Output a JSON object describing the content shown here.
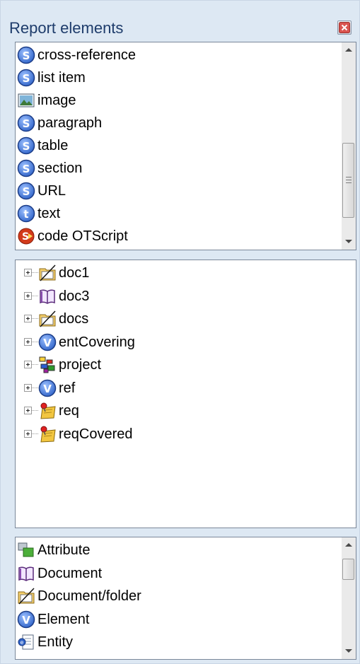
{
  "panel": {
    "title": "Report elements",
    "close_icon": "close-icon"
  },
  "report_elements": [
    {
      "label": "cross-reference",
      "icon": "s-badge-icon"
    },
    {
      "label": "list item",
      "icon": "s-badge-icon"
    },
    {
      "label": "image",
      "icon": "image-icon"
    },
    {
      "label": "paragraph",
      "icon": "s-badge-icon"
    },
    {
      "label": "table",
      "icon": "s-badge-icon"
    },
    {
      "label": "section",
      "icon": "s-badge-icon"
    },
    {
      "label": "URL",
      "icon": "s-badge-icon"
    },
    {
      "label": "text",
      "icon": "t-badge-icon"
    },
    {
      "label": "code OTScript",
      "icon": "script-icon"
    }
  ],
  "project_tree": [
    {
      "label": "doc1",
      "icon": "folder-crossed-icon"
    },
    {
      "label": "doc3",
      "icon": "book-icon"
    },
    {
      "label": "docs",
      "icon": "folder-crossed-icon"
    },
    {
      "label": "entCovering",
      "icon": "v-badge-icon"
    },
    {
      "label": "project",
      "icon": "project-icon"
    },
    {
      "label": "ref",
      "icon": "v-badge-icon"
    },
    {
      "label": "req",
      "icon": "requirement-pin-icon"
    },
    {
      "label": "reqCovered",
      "icon": "requirement-pin-icon"
    }
  ],
  "element_types": [
    {
      "label": "Attribute",
      "icon": "attribute-icon"
    },
    {
      "label": "Document",
      "icon": "book-icon"
    },
    {
      "label": "Document/folder",
      "icon": "folder-crossed-icon"
    },
    {
      "label": "Element",
      "icon": "v-badge-icon"
    },
    {
      "label": "Entity",
      "icon": "entity-icon"
    }
  ],
  "scroll": {
    "grip_glyph": "≡"
  },
  "colors": {
    "badge_blue": "#2f63c8",
    "badge_border": "#1b3c87",
    "frame_bg": "#dde8f3",
    "title_text": "#1e3c6b",
    "script_red": "#d23a1a"
  }
}
